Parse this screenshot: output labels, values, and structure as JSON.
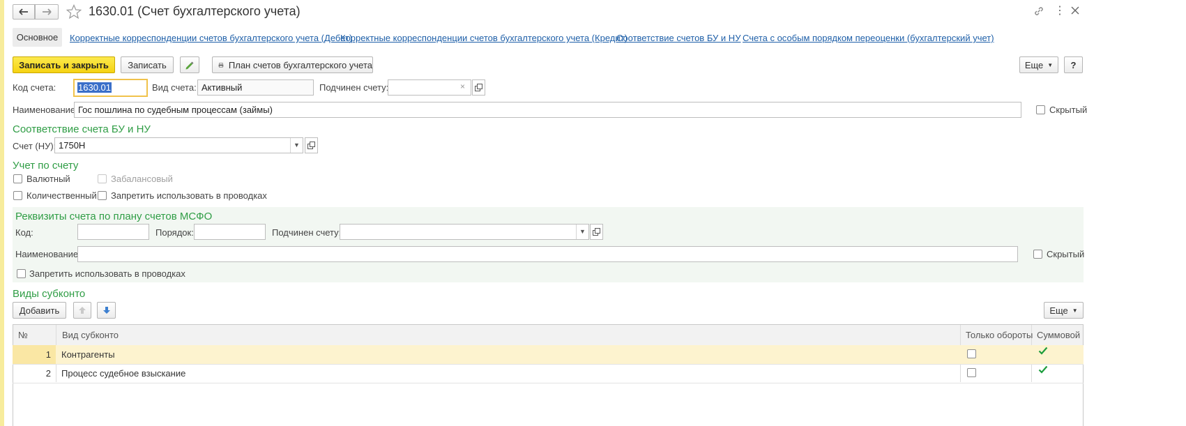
{
  "window": {
    "title": "1630.01 (Счет бухгалтерского учета)"
  },
  "tabs": {
    "main": "Основное",
    "debit": "Корректные корреспонденции счетов бухгалтерского учета (Дебет)",
    "credit": "Корректные корреспонденции счетов бухгалтерского учета (Кредит)",
    "bu_nu": "Соответствие счетов БУ и НУ",
    "revaluation": "Счета с особым порядком переоценки (бухгалтерский учет)"
  },
  "toolbar": {
    "save_close": "Записать и закрыть",
    "save": "Записать",
    "chart_of_accounts": "План счетов бухгалтерского учета",
    "more": "Еще",
    "help": "?"
  },
  "form": {
    "code_label": "Код счета:",
    "code_value": "1630.01",
    "type_label": "Вид счета:",
    "type_value": "Активный",
    "parent_label": "Подчинен счету:",
    "parent_value": "",
    "name_label": "Наименование:",
    "name_value": "Гос пошлина по судебным процессам (займы)",
    "hidden_label": "Скрытый"
  },
  "bu_nu_section": {
    "title": "Соответствие счета БУ и НУ",
    "tax_account_label": "Счет (НУ):",
    "tax_account_value": "1750Н"
  },
  "accounting_section": {
    "title": "Учет по счету",
    "currency": "Валютный",
    "offbalance": "Забалансовый",
    "quantitative": "Количественный",
    "forbid_postings": "Запретить использовать в проводках"
  },
  "ifrs_section": {
    "title": "Реквизиты счета по плану счетов МСФО",
    "code_label": "Код:",
    "order_label": "Порядок:",
    "parent_label": "Подчинен счету:",
    "name_label": "Наименование:",
    "hidden_label": "Скрытый",
    "forbid_postings": "Запретить использовать в проводках"
  },
  "subconto": {
    "title": "Виды субконто",
    "add": "Добавить",
    "more": "Еще",
    "columns": {
      "num": "№",
      "kind": "Вид субконто",
      "turnover_only": "Только обороты",
      "sum": "Суммовой"
    },
    "rows": [
      {
        "num": "1",
        "kind": "Контрагенты",
        "turnover_only": false,
        "sum": true
      },
      {
        "num": "2",
        "kind": "Процесс судебное взыскание",
        "turnover_only": false,
        "sum": true
      }
    ]
  },
  "colors": {
    "accent_green": "#2f9d45",
    "link_blue": "#1e5fa8",
    "primary_button": "#f5d212",
    "selected_row": "#fdf3cf"
  }
}
